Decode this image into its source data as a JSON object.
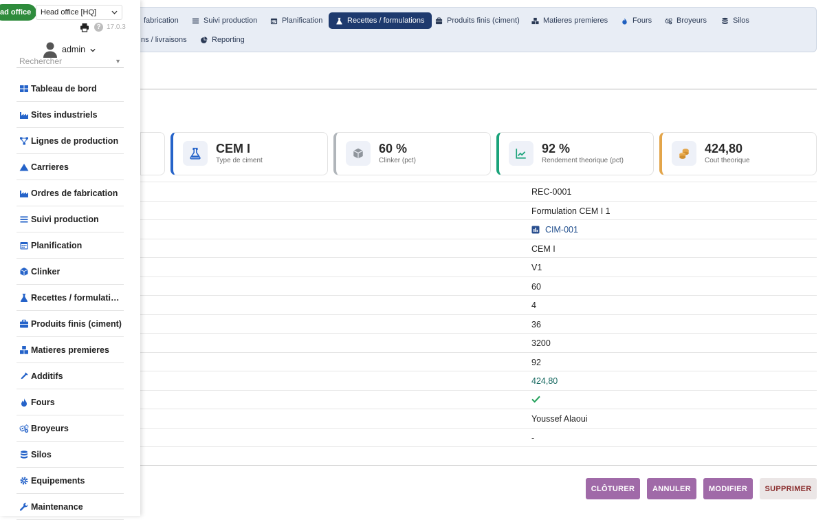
{
  "topmenu": {
    "items": [
      {
        "label": "fabrication",
        "icon": "factory-icon"
      },
      {
        "label": "Suivi production",
        "icon": "list-icon"
      },
      {
        "label": "Planification",
        "icon": "calendar-icon"
      },
      {
        "label": "Recettes / formulations",
        "icon": "flask-icon",
        "active": true
      },
      {
        "label": "Produits finis (ciment)",
        "icon": "briefcase-icon"
      },
      {
        "label": "Matieres premieres",
        "icon": "boxes-icon"
      },
      {
        "label": "Fours",
        "icon": "flame-icon"
      },
      {
        "label": "Broyeurs",
        "icon": "gears-icon"
      },
      {
        "label": "Silos",
        "icon": "database-icon"
      },
      {
        "label": "ns / livraisons",
        "icon": ""
      },
      {
        "label": "Reporting",
        "icon": "pie-chart-icon"
      }
    ]
  },
  "kpis": [
    {
      "value": "CEM I",
      "label": "Type de ciment",
      "icon": "flask-icon",
      "accent": "#2563c9"
    },
    {
      "value": "60 %",
      "label": "Clinker (pct)",
      "icon": "cube-icon",
      "accent": "#b0b5ba"
    },
    {
      "value": "92 %",
      "label": "Rendement theorique (pct)",
      "icon": "line-chart-icon",
      "accent": "#1aa37a"
    },
    {
      "value": "424,80",
      "label": "Cout theorique",
      "icon": "coins-icon",
      "accent": "#e3a54a"
    }
  ],
  "record": {
    "values": [
      "REC-0001",
      "Formulation CEM I 1",
      "CIM-001",
      "CEM I",
      "V1",
      "60",
      "4",
      "36",
      "3200",
      "92",
      "424,80",
      "",
      "Youssef Alaoui",
      "-",
      ""
    ]
  },
  "actions": {
    "close": "CLÔTURER",
    "cancel": "ANNULER",
    "modify": "MODIFIER",
    "delete": "SUPPRIMER"
  },
  "sidebar": {
    "entity_badge": "ad office",
    "entity_select": "Head office [HQ]",
    "version": "17.0.3",
    "user": "admin",
    "search_placeholder": "Rechercher",
    "items": [
      {
        "label": "Tableau de bord",
        "icon": "dashboard-icon"
      },
      {
        "label": "Sites industriels",
        "icon": "factory-icon"
      },
      {
        "label": "Lignes de production",
        "icon": "sitemap-icon"
      },
      {
        "label": "Carrieres",
        "icon": "mountain-icon"
      },
      {
        "label": "Ordres de fabrication",
        "icon": "factory-icon"
      },
      {
        "label": "Suivi production",
        "icon": "list-icon"
      },
      {
        "label": "Planification",
        "icon": "calendar-icon"
      },
      {
        "label": "Clinker",
        "icon": "cube-icon"
      },
      {
        "label": "Recettes / formulatio…",
        "icon": "flask-icon"
      },
      {
        "label": "Produits finis (ciment)",
        "icon": "briefcase-icon"
      },
      {
        "label": "Matieres premieres",
        "icon": "boxes-icon"
      },
      {
        "label": "Additifs",
        "icon": "eyedropper-icon"
      },
      {
        "label": "Fours",
        "icon": "flame-icon"
      },
      {
        "label": "Broyeurs",
        "icon": "gears-icon"
      },
      {
        "label": "Silos",
        "icon": "database-icon"
      },
      {
        "label": "Equipements",
        "icon": "gear-icon"
      },
      {
        "label": "Maintenance",
        "icon": "wrench-icon"
      }
    ]
  },
  "colors": {
    "primary": "#1e3a6e",
    "accent_blue": "#2563c9",
    "action": "#a06aa8",
    "green": "#2e8b3c"
  }
}
